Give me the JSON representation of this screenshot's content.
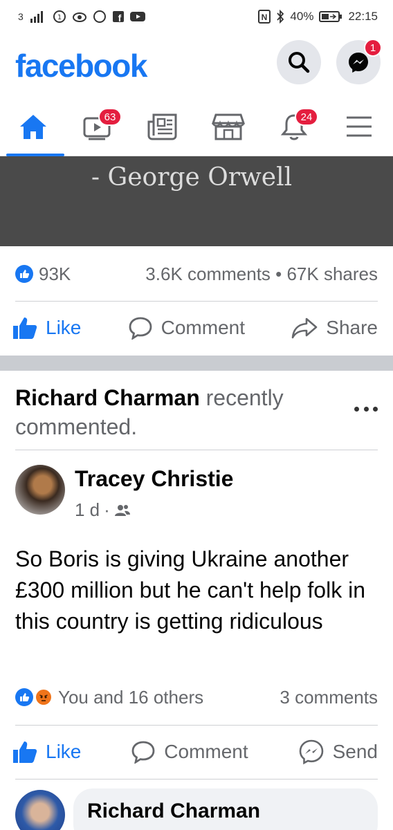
{
  "status_bar": {
    "carrier": "3",
    "bluetooth_battery": "40%",
    "time": "22:15"
  },
  "header": {
    "logo": "facebook",
    "messenger_badge": "1"
  },
  "tabs": {
    "video_badge": "63",
    "notifications_badge": "24"
  },
  "shared_post": {
    "quote_caption": "- George Orwell",
    "reactions_count": "93K",
    "comments_shares": "3.6K comments • 67K shares"
  },
  "actions": {
    "like": "Like",
    "comment": "Comment",
    "share": "Share",
    "send": "Send"
  },
  "activity": {
    "actor": "Richard Charman",
    "text": " recently commented."
  },
  "post": {
    "author": "Tracey Christie",
    "time": "1 d",
    "dot": "·",
    "body": "So Boris is giving Ukraine another £300 million but he can't help folk in this country is getting ridiculous",
    "reactions_text": "You and 16 others",
    "comments_count": "3 comments"
  },
  "comment": {
    "author": "Richard Charman"
  },
  "colors": {
    "brand": "#1877f2",
    "badge": "#e41e3f",
    "secondary_text": "#65676b"
  }
}
